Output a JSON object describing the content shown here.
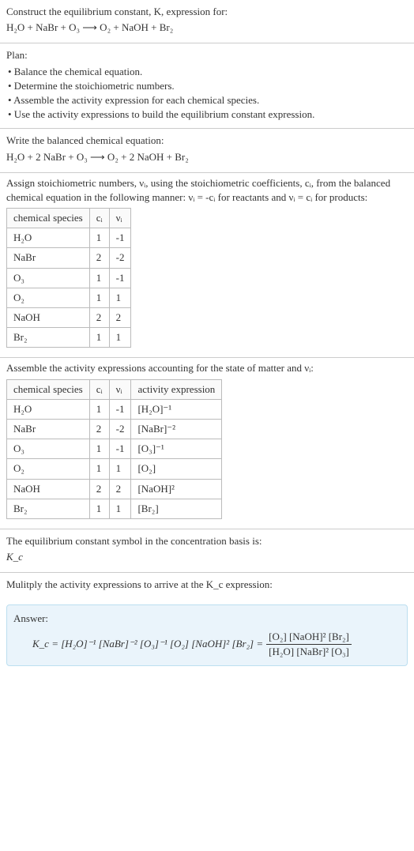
{
  "s1": {
    "line1": "Construct the equilibrium constant, K, expression for:",
    "line2": "H₂O + NaBr + O₃ ⟶ O₂ + NaOH + Br₂"
  },
  "s2": {
    "title": "Plan:",
    "b1": "• Balance the chemical equation.",
    "b2": "• Determine the stoichiometric numbers.",
    "b3": "• Assemble the activity expression for each chemical species.",
    "b4": "• Use the activity expressions to build the equilibrium constant expression."
  },
  "s3": {
    "line1": "Write the balanced chemical equation:",
    "line2": "H₂O + 2 NaBr + O₃ ⟶ O₂ + 2 NaOH + Br₂"
  },
  "s4": {
    "intro": "Assign stoichiometric numbers, νᵢ, using the stoichiometric coefficients, cᵢ, from the balanced chemical equation in the following manner: νᵢ = -cᵢ for reactants and νᵢ = cᵢ for products:",
    "headers": {
      "h1": "chemical species",
      "h2": "cᵢ",
      "h3": "νᵢ"
    },
    "rows": [
      {
        "sp": "H₂O",
        "c": "1",
        "v": "-1"
      },
      {
        "sp": "NaBr",
        "c": "2",
        "v": "-2"
      },
      {
        "sp": "O₃",
        "c": "1",
        "v": "-1"
      },
      {
        "sp": "O₂",
        "c": "1",
        "v": "1"
      },
      {
        "sp": "NaOH",
        "c": "2",
        "v": "2"
      },
      {
        "sp": "Br₂",
        "c": "1",
        "v": "1"
      }
    ]
  },
  "s5": {
    "intro": "Assemble the activity expressions accounting for the state of matter and νᵢ:",
    "headers": {
      "h1": "chemical species",
      "h2": "cᵢ",
      "h3": "νᵢ",
      "h4": "activity expression"
    },
    "rows": [
      {
        "sp": "H₂O",
        "c": "1",
        "v": "-1",
        "a": "[H₂O]⁻¹"
      },
      {
        "sp": "NaBr",
        "c": "2",
        "v": "-2",
        "a": "[NaBr]⁻²"
      },
      {
        "sp": "O₃",
        "c": "1",
        "v": "-1",
        "a": "[O₃]⁻¹"
      },
      {
        "sp": "O₂",
        "c": "1",
        "v": "1",
        "a": "[O₂]"
      },
      {
        "sp": "NaOH",
        "c": "2",
        "v": "2",
        "a": "[NaOH]²"
      },
      {
        "sp": "Br₂",
        "c": "1",
        "v": "1",
        "a": "[Br₂]"
      }
    ]
  },
  "s6": {
    "line1": "The equilibrium constant symbol in the concentration basis is:",
    "line2": "K_c"
  },
  "s7": {
    "line1": "Mulitply the activity expressions to arrive at the K_c expression:"
  },
  "answer": {
    "label": "Answer:",
    "lead": "K_c = [H₂O]⁻¹ [NaBr]⁻² [O₃]⁻¹ [O₂] [NaOH]² [Br₂] =",
    "num": "[O₂] [NaOH]² [Br₂]",
    "den": "[H₂O] [NaBr]² [O₃]"
  }
}
